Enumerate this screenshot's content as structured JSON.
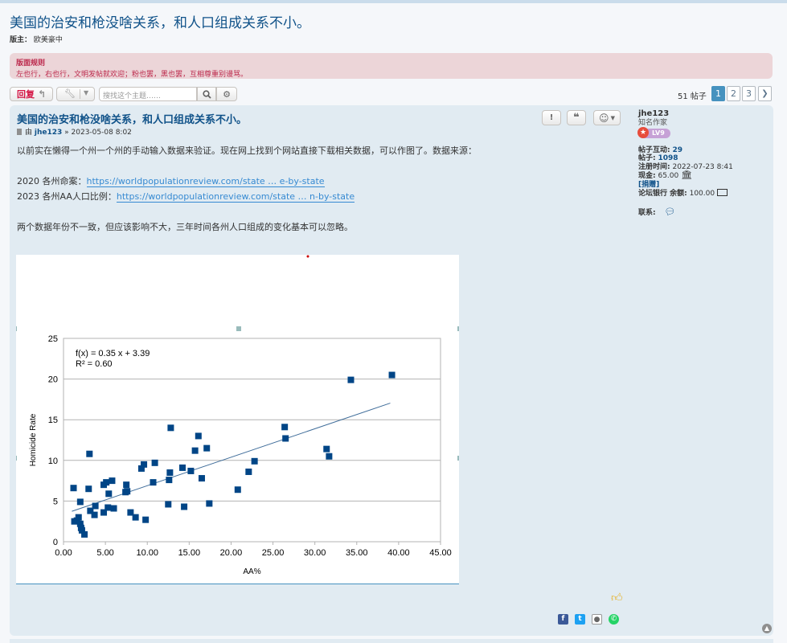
{
  "topic": {
    "title": "美国的治安和枪没啥关系，和人口组成关系不小。",
    "moderator_label": "版主：",
    "moderator": "欧美豪中"
  },
  "rules": {
    "title": "版面规则",
    "text": "左也行，右也行，文明发帖就欢迎；粉也罢，黑也罢，互相尊重别谩骂。"
  },
  "toolbar": {
    "reply_label": "回复",
    "search_placeholder": "搜找这个主题……",
    "post_count": "51 帖子",
    "pages": [
      "1",
      "2",
      "3"
    ],
    "active_page": "1"
  },
  "post": {
    "title": "美国的治安和枪没啥关系，和人口组成关系不小。",
    "by": "由",
    "author": "jhe123",
    "date": "» 2023-05-08 8:02",
    "line1": "以前实在懒得一个州一个州的手动输入数据来验证。现在网上找到个网站直接下载相关数据，可以作图了。数据来源：",
    "line2_label": "2020 各州命案：",
    "line2_link": "https://worldpopulationreview.com/state … e-by-state",
    "line3_label": "2023 各州AA人口比例：",
    "line3_link": "https://worldpopulationreview.com/state … n-by-state",
    "line4": "两个数据年份不一致，但应该影响不大，三年时间各州人口组成的变化基本可以忽略。"
  },
  "profile": {
    "username": "jhe123",
    "rank": "知名作家",
    "level": "LV9",
    "interactions_label": "帖子互动:",
    "interactions": "29",
    "posts_label": "帖子:",
    "posts": "1098",
    "joined_label": "注册时间:",
    "joined": "2022-07-23 8:41",
    "cash_label": "现金:",
    "cash": "65.00",
    "donate_label": "[捐赠]",
    "bank_label": "论坛银行 余额:",
    "bank": "100.00",
    "contact_label": "联系:"
  },
  "colors": {
    "accent": "#105289",
    "marker": "#004586",
    "trendline": "#3f6d9a",
    "rules_bg": "#ecd5d8",
    "post_bg": "#e1ebf2"
  },
  "chart_data": {
    "type": "scatter",
    "title": "",
    "xlabel": "AA%",
    "ylabel": "Homicide Rate",
    "xlim": [
      0,
      45
    ],
    "ylim": [
      0,
      25
    ],
    "xticks": [
      "0.00",
      "5.00",
      "10.00",
      "15.00",
      "20.00",
      "25.00",
      "30.00",
      "35.00",
      "40.00",
      "45.00"
    ],
    "yticks": [
      "0",
      "5",
      "10",
      "15",
      "20",
      "25"
    ],
    "grid": "horizontal",
    "annotation_line1": "f(x) = 0.35 x + 3.39",
    "annotation_line2": "R² = 0.60",
    "trend": {
      "slope": 0.35,
      "intercept": 3.39,
      "x_from": 1.0,
      "x_to": 39.0
    },
    "points": [
      [
        1.2,
        6.6
      ],
      [
        1.3,
        2.5
      ],
      [
        1.6,
        2.6
      ],
      [
        1.8,
        3.0
      ],
      [
        2.0,
        4.9
      ],
      [
        2.0,
        2.2
      ],
      [
        2.1,
        1.7
      ],
      [
        2.2,
        1.4
      ],
      [
        2.5,
        0.9
      ],
      [
        3.0,
        6.5
      ],
      [
        3.1,
        10.8
      ],
      [
        3.2,
        3.8
      ],
      [
        3.7,
        3.3
      ],
      [
        3.8,
        4.4
      ],
      [
        4.8,
        3.6
      ],
      [
        4.8,
        7.0
      ],
      [
        5.1,
        7.3
      ],
      [
        5.3,
        4.2
      ],
      [
        5.4,
        5.9
      ],
      [
        5.8,
        7.5
      ],
      [
        6.0,
        4.1
      ],
      [
        7.4,
        6.1
      ],
      [
        7.5,
        7.0
      ],
      [
        7.6,
        6.2
      ],
      [
        8.0,
        3.6
      ],
      [
        8.6,
        3.0
      ],
      [
        9.3,
        9.0
      ],
      [
        9.6,
        9.5
      ],
      [
        9.8,
        2.7
      ],
      [
        10.7,
        7.3
      ],
      [
        10.9,
        9.7
      ],
      [
        12.5,
        4.6
      ],
      [
        12.6,
        7.6
      ],
      [
        12.7,
        8.5
      ],
      [
        12.8,
        14.0
      ],
      [
        14.2,
        9.1
      ],
      [
        14.4,
        4.3
      ],
      [
        15.2,
        8.7
      ],
      [
        15.7,
        11.2
      ],
      [
        16.1,
        13.0
      ],
      [
        16.5,
        7.8
      ],
      [
        17.1,
        11.5
      ],
      [
        17.4,
        4.7
      ],
      [
        20.8,
        6.4
      ],
      [
        22.1,
        8.6
      ],
      [
        22.8,
        9.9
      ],
      [
        26.4,
        14.1
      ],
      [
        26.5,
        12.7
      ],
      [
        31.4,
        11.4
      ],
      [
        31.7,
        10.5
      ],
      [
        34.3,
        19.9
      ],
      [
        39.2,
        20.5
      ]
    ]
  }
}
